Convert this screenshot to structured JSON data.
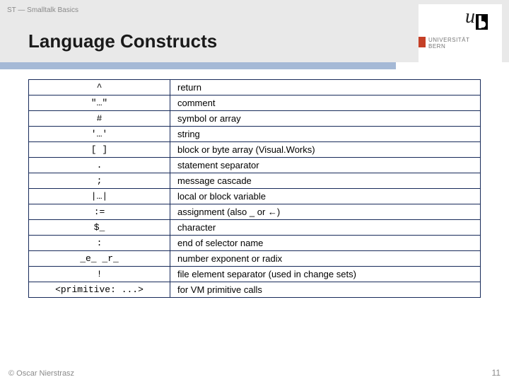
{
  "header": {
    "breadcrumb": "ST — Smalltalk Basics",
    "title": "Language Constructs",
    "logo_u": "u",
    "university_line1": "UNIVERSITÄT",
    "university_line2": "BERN"
  },
  "table": {
    "rows": [
      {
        "symbol": "^",
        "description": "return"
      },
      {
        "symbol": "\"…\"",
        "description": "comment"
      },
      {
        "symbol": "#",
        "description": "symbol or array"
      },
      {
        "symbol": "'…'",
        "description": "string"
      },
      {
        "symbol": "[ ]",
        "description": "block or byte array (Visual.Works)"
      },
      {
        "symbol": ".",
        "description": "statement separator"
      },
      {
        "symbol": ";",
        "description": "message cascade"
      },
      {
        "symbol": "|…|",
        "description": "local or block variable"
      },
      {
        "symbol": ":=",
        "description": "assignment (also _ or ←)"
      },
      {
        "symbol": "$_",
        "description": "character"
      },
      {
        "symbol": ":",
        "description": "end of selector name"
      },
      {
        "symbol": "_e_ _r_",
        "description": "number exponent or radix"
      },
      {
        "symbol": "!",
        "description": "file element separator (used in change sets)"
      },
      {
        "symbol": "<primitive: ...>",
        "description": "for VM primitive calls"
      }
    ]
  },
  "footer": {
    "copyright": "© Oscar Nierstrasz",
    "page": "11"
  }
}
